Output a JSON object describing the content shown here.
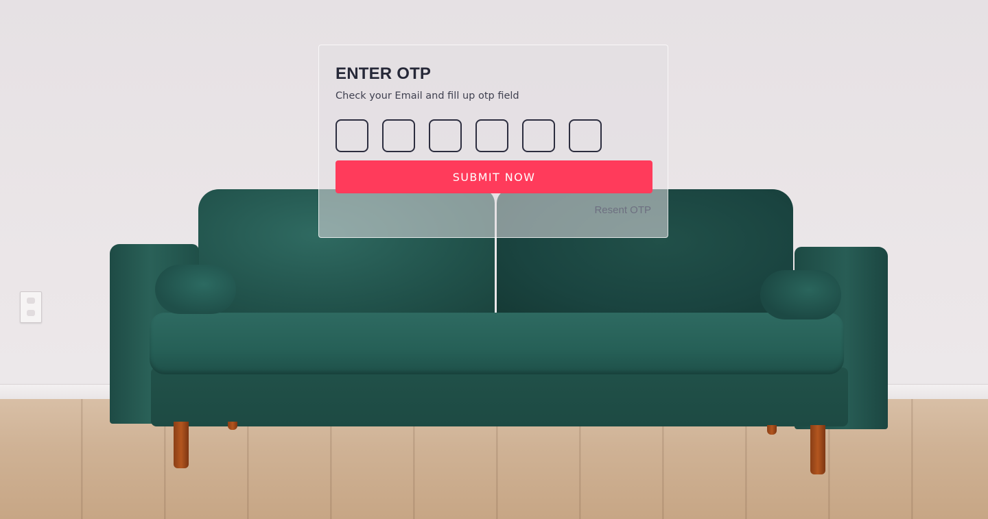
{
  "otp_card": {
    "title": "ENTER OTP",
    "subtitle": "Check your Email and fill up otp field",
    "otp_digits": [
      "",
      "",
      "",
      "",
      "",
      ""
    ],
    "submit_label": "SUBMIT NOW",
    "resend_label": "Resent OTP"
  },
  "colors": {
    "accent": "#ff3b5b",
    "title_text": "#262838",
    "box_border": "#2c2d3f",
    "muted_link": "#6d6f80"
  },
  "background": {
    "scene": "green-velvet-sofa-in-room"
  }
}
